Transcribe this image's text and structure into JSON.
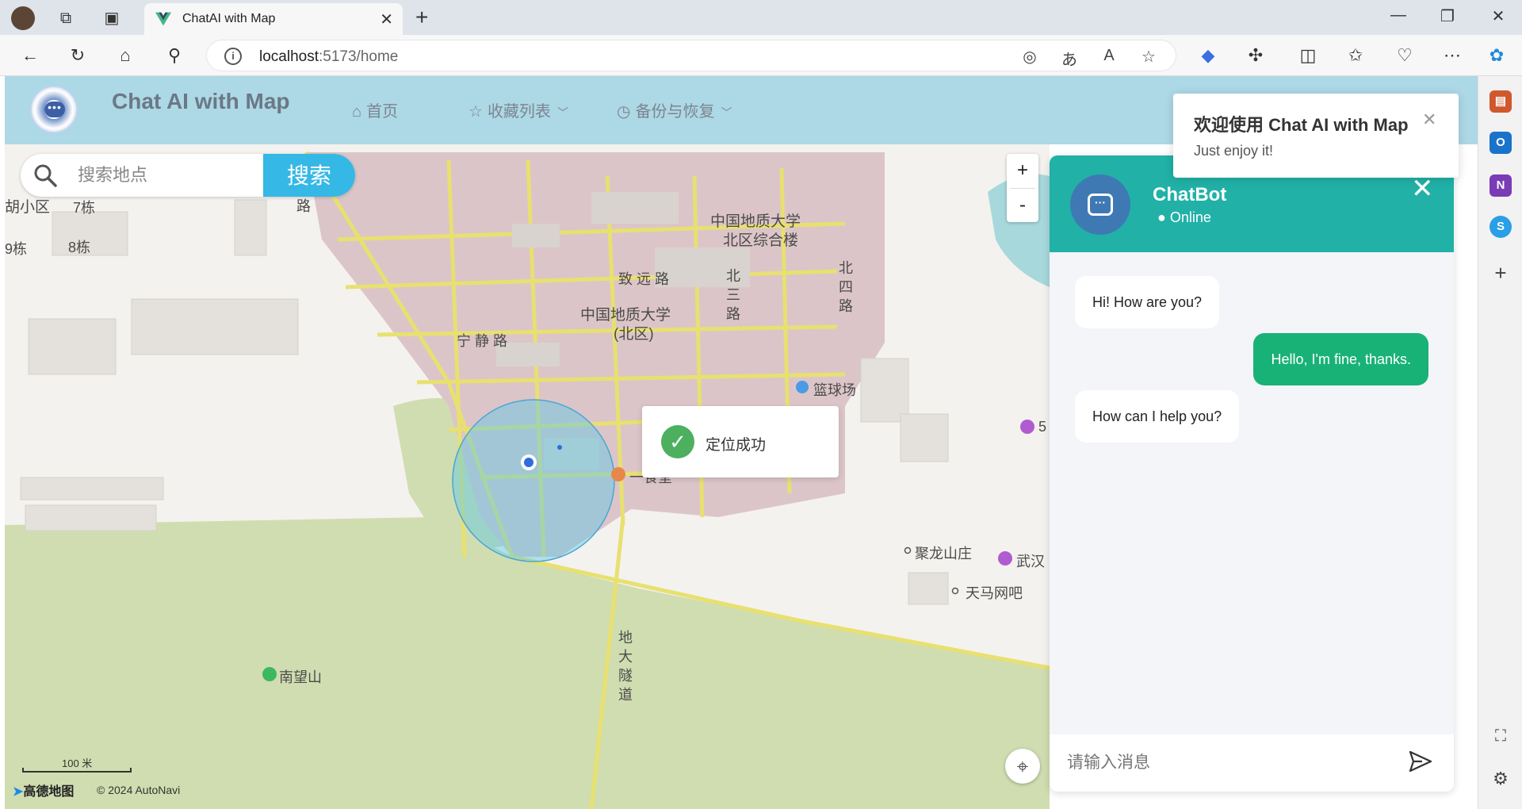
{
  "browser": {
    "tab_title": "ChatAI with Map",
    "url_host": "localhost",
    "url_rest": ":5173/home"
  },
  "app": {
    "title": "Chat AI with Map",
    "menu": [
      {
        "label": "首页",
        "icon": "home-icon"
      },
      {
        "label": "收藏列表",
        "icon": "star-icon"
      },
      {
        "label": "备份与恢复",
        "icon": "clock-icon"
      }
    ]
  },
  "search": {
    "placeholder": "搜索地点",
    "button": "搜索"
  },
  "map": {
    "zoom_in": "+",
    "zoom_out": "-",
    "toast": "定位成功",
    "labels": {
      "hu_xiaoqu": "胡小区",
      "b7": "7栋",
      "b9": "9栋",
      "b8": "8栋",
      "lu": "路",
      "cugb_north_complex_1": "中国地质大学",
      "cugb_north_complex_2": "北区综合楼",
      "zhiyuan_road": "致 远 路",
      "bei3_road": "北三路",
      "bei4_road": "北四路",
      "cugb_1": "中国地质大学",
      "cugb_2": "(北区)",
      "ningjing_road": "宁 静 路",
      "basketball": "篮球场",
      "canteen": "一食堂",
      "tunnel": "地大隧道",
      "julong": "聚龙山庄",
      "wuhan": "武汉",
      "tianma": "天马网吧",
      "nanwang": "南望山",
      "five": "5"
    },
    "scale": "100 米",
    "brand": "高德地图",
    "copyright": "© 2024 AutoNavi"
  },
  "chat": {
    "name": "ChatBot",
    "status": "Online",
    "messages": [
      {
        "role": "bot",
        "text": "Hi! How are you?"
      },
      {
        "role": "user",
        "text": "Hello, I'm fine, thanks."
      },
      {
        "role": "bot",
        "text": "How can I help you?"
      }
    ],
    "input_placeholder": "请输入消息"
  },
  "notice": {
    "title": "欢迎使用 Chat AI with Map",
    "text": "Just enjoy it!"
  },
  "colors": {
    "header_bg": "#add8e6",
    "search_button": "#35b8e6",
    "chat_header": "#21b1a7",
    "user_bubble": "#19b276"
  }
}
